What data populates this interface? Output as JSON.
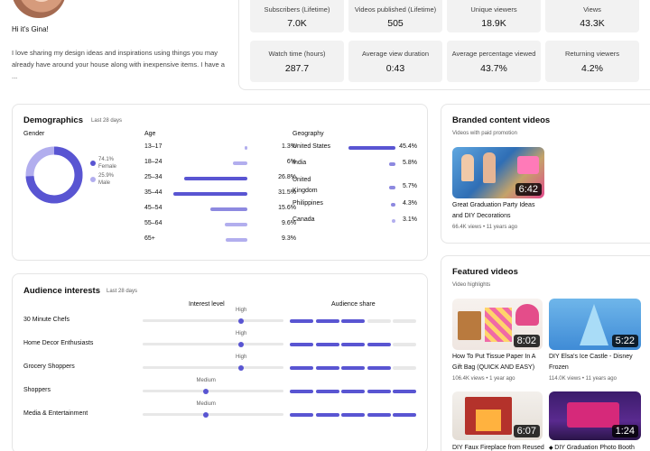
{
  "profile": {
    "greeting": "Hi it's Gina!",
    "bio": "I love sharing my design ideas and inspirations using things you may already have around your house along with inexpensive items. I have a ..."
  },
  "stats": [
    {
      "label": "Subscribers (Lifetime)",
      "value": "7.0K"
    },
    {
      "label": "Videos published (Lifetime)",
      "value": "505"
    },
    {
      "label": "Unique viewers",
      "value": "18.9K"
    },
    {
      "label": "Views",
      "value": "43.3K"
    },
    {
      "label": "Watch time (hours)",
      "value": "287.7"
    },
    {
      "label": "Average view duration",
      "value": "0:43"
    },
    {
      "label": "Average percentage viewed",
      "value": "43.7%"
    },
    {
      "label": "Returning viewers",
      "value": "4.2%"
    }
  ],
  "demographics": {
    "title": "Demographics",
    "period": "Last 28 days",
    "gender": {
      "label": "Gender",
      "female_pct": "74.1%",
      "female_label": "Female",
      "male_pct": "25.9%",
      "male_label": "Male",
      "female_fraction": 0.741
    },
    "age": {
      "label": "Age",
      "rows": [
        {
          "range": "13–17",
          "pct": "1.3%",
          "value": 1.3
        },
        {
          "range": "18–24",
          "pct": "6%",
          "value": 6
        },
        {
          "range": "25–34",
          "pct": "26.8%",
          "value": 26.8
        },
        {
          "range": "35–44",
          "pct": "31.5%",
          "value": 31.5
        },
        {
          "range": "45–54",
          "pct": "15.6%",
          "value": 15.6
        },
        {
          "range": "55–64",
          "pct": "9.6%",
          "value": 9.6
        },
        {
          "range": "65+",
          "pct": "9.3%",
          "value": 9.3
        }
      ]
    },
    "geography": {
      "label": "Geography",
      "rows": [
        {
          "country": "United States",
          "pct": "45.4%",
          "value": 45.4
        },
        {
          "country": "India",
          "pct": "5.8%",
          "value": 5.8
        },
        {
          "country": "United Kingdom",
          "pct": "5.7%",
          "value": 5.7
        },
        {
          "country": "Philippines",
          "pct": "4.3%",
          "value": 4.3
        },
        {
          "country": "Canada",
          "pct": "3.1%",
          "value": 3.1
        }
      ]
    }
  },
  "audience_interests": {
    "title": "Audience interests",
    "period": "Last 28 days",
    "col_interest": "Interest level",
    "col_share": "Audience share",
    "rows": [
      {
        "name": "30 Minute Chefs",
        "level": "High",
        "level_value": 0.7,
        "share_segments": 3
      },
      {
        "name": "Home Decor Enthusiasts",
        "level": "High",
        "level_value": 0.7,
        "share_segments": 4
      },
      {
        "name": "Grocery Shoppers",
        "level": "High",
        "level_value": 0.7,
        "share_segments": 4
      },
      {
        "name": "Shoppers",
        "level": "Medium",
        "level_value": 0.45,
        "share_segments": 5
      },
      {
        "name": "Media & Entertainment",
        "level": "Medium",
        "level_value": 0.45,
        "share_segments": 5
      }
    ]
  },
  "branded": {
    "title": "Branded content videos",
    "subtitle": "Videos with paid promotion",
    "video": {
      "duration": "6:42",
      "title_line1": "Great Graduation Party Ideas",
      "title_line2": "and DIY Decorations",
      "meta": "66.4K views • 11 years ago"
    }
  },
  "featured": {
    "title": "Featured videos",
    "subtitle": "Video highlights",
    "videos": [
      {
        "duration": "8:02",
        "title_line1": "How To Put Tissue Paper In A",
        "title_line2": "Gift Bag (QUICK AND EASY)",
        "meta": "106.4K views • 1 year ago"
      },
      {
        "duration": "5:22",
        "title_line1": "DIY Elsa's Ice Castle - Disney",
        "title_line2": "Frozen",
        "meta": "114.0K views • 11 years ago"
      },
      {
        "duration": "6:07",
        "title_line1": "DIY Faux Fireplace from Reused",
        "title_line2": "",
        "meta": ""
      },
      {
        "duration": "1:24",
        "title_line1": "DIY Graduation Photo Booth",
        "title_line2": "",
        "meta": ""
      }
    ]
  },
  "colors": {
    "accent": "#5955d2",
    "accent_light": "#b2aeee",
    "tile_bg": "#f2f2f2"
  }
}
